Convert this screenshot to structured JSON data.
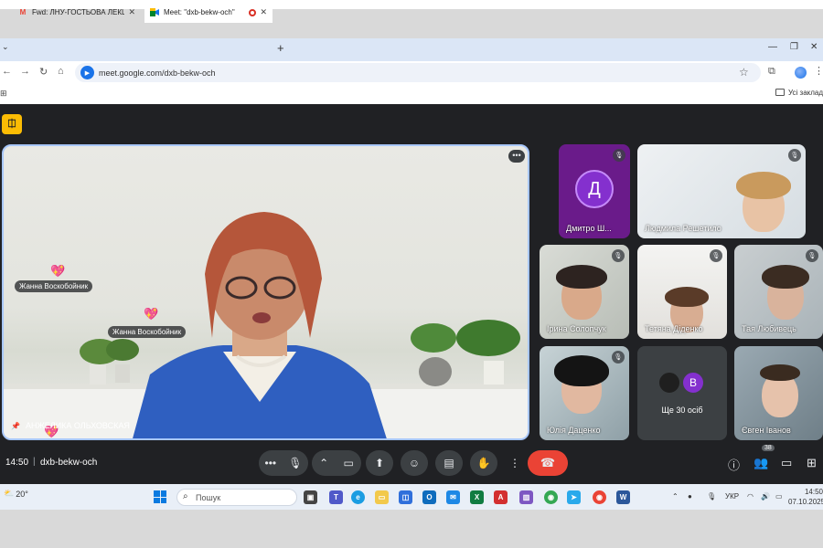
{
  "browser": {
    "tabs": [
      {
        "title": "Fwd: ЛНУ-ГОСТЬОВА ЛЕКЦІЯ-",
        "favicon": "gmail-icon",
        "active": false
      },
      {
        "title": "Meet: \"dxb-bekw-och\"",
        "favicon": "meet-icon",
        "active": true,
        "recording": true
      }
    ],
    "url": "meet.google.com/dxb-bekw-och",
    "bookmarks_label": "Усі закладки"
  },
  "meet": {
    "main_speaker": "АНЖЕЛИКА ОЛЬХОВСКАЯ",
    "reactions": [
      {
        "name": "Жанна Воскобойник",
        "emoji": "💖"
      },
      {
        "name": "Жанна Воскобойник",
        "emoji": "💖"
      }
    ],
    "participants": [
      {
        "name": "Дмитро Ш...",
        "avatar_letter": "Д",
        "mic_muted": true
      },
      {
        "name": "Людмила Решетило",
        "mic_muted": true
      },
      {
        "name": "Ірина Солопчук",
        "mic_muted": true
      },
      {
        "name": "Тетяна Діденко",
        "mic_muted": true
      },
      {
        "name": "Тая Любивець",
        "mic_muted": true
      },
      {
        "name": "Юлія Даценко",
        "mic_muted": true
      },
      {
        "name": "Євген Іванов",
        "mic_muted": false
      }
    ],
    "more_people": {
      "label": "Ще 30 осіб",
      "avatar_letter": "В"
    },
    "time": "14:50",
    "meeting_code": "dxb-bekw-och",
    "participant_count": "38",
    "colors": {
      "background": "#202124",
      "control": "#3c4043",
      "hangup": "#ea4335",
      "active_border": "#a8c7fa"
    }
  },
  "taskbar": {
    "weather": "20°",
    "search_placeholder": "Пошук",
    "language": "УКР",
    "clock_time": "14:50",
    "clock_date": "07.10.2025"
  }
}
